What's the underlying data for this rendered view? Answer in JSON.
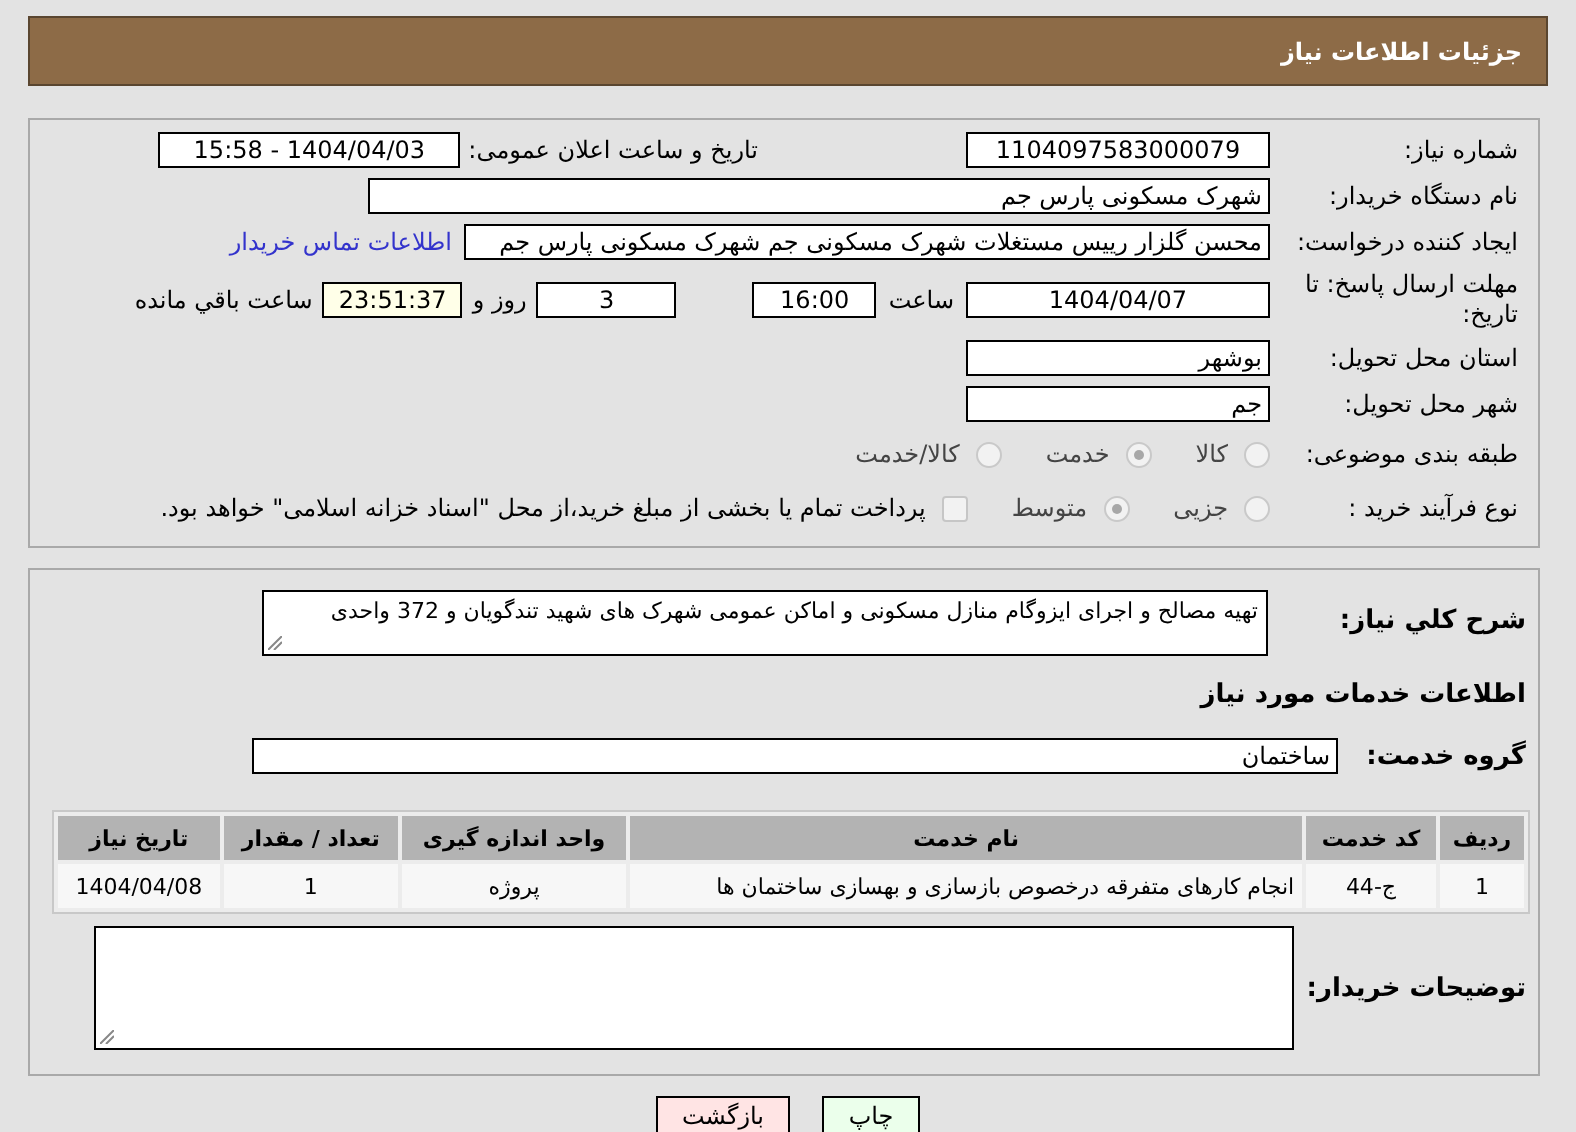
{
  "header": {
    "title": "جزئیات اطلاعات نیاز"
  },
  "details": {
    "need_number": {
      "label": "شماره نیاز:",
      "value": "1104097583000079"
    },
    "announce": {
      "label": "تاریخ و ساعت اعلان عمومی:",
      "value": "1404/04/03 - 15:58"
    },
    "buyer": {
      "label": "نام دستگاه خریدار:",
      "value": "شهرک مسکونی پارس جم"
    },
    "creator": {
      "label": "ایجاد کننده درخواست:",
      "value": "محسن گلزار رییس مستغلات شهرک مسکونی جم شهرک مسکونی پارس جم",
      "link": "اطلاعات تماس خریدار"
    },
    "deadline": {
      "label": "مهلت ارسال پاسخ: تا تاریخ:",
      "date": "1404/04/07",
      "time_label": "ساعت",
      "time": "16:00",
      "days": "3",
      "days_label": "روز و",
      "remaining": "23:51:37",
      "remaining_label": "ساعت باقي مانده"
    },
    "province": {
      "label": "استان محل تحویل:",
      "value": "بوشهر"
    },
    "city": {
      "label": "شهر محل تحویل:",
      "value": "جم"
    },
    "category": {
      "label": "طبقه بندی موضوعی:",
      "options": [
        {
          "label": "کالا",
          "selected": false
        },
        {
          "label": "خدمت",
          "selected": true
        },
        {
          "label": "کالا/خدمت",
          "selected": false
        }
      ]
    },
    "process": {
      "label": "نوع فرآیند خرید :",
      "options": [
        {
          "label": "جزیی",
          "selected": false
        },
        {
          "label": "متوسط",
          "selected": true
        }
      ],
      "payment": {
        "label": "پرداخت تمام یا بخشی از مبلغ خرید،از محل \"اسناد خزانه اسلامی\" خواهد بود.",
        "checked": false
      }
    }
  },
  "need": {
    "description": {
      "label": "شرح كلي نياز:",
      "value": "تهیه مصالح و اجرای ایزوگام منازل مسکونی و اماکن عمومی شهرک های شهید تندگویان و 372 واحدی"
    },
    "services_title": "اطلاعات خدمات مورد نیاز",
    "service_group": {
      "label": "گروه خدمت:",
      "value": "ساختمان"
    },
    "table": {
      "columns": [
        "ردیف",
        "کد خدمت",
        "نام خدمت",
        "واحد اندازه گیری",
        "تعداد / مقدار",
        "تاریخ نیاز"
      ],
      "rows": [
        [
          "1",
          "ج-44",
          "انجام کارهای متفرقه درخصوص بازسازی و بهسازی ساختمان ها",
          "پروژه",
          "1",
          "1404/04/08"
        ]
      ]
    },
    "buyer_notes": {
      "label": "توضیحات خریدار:"
    }
  },
  "buttons": [
    {
      "label": "چاپ",
      "kind": "print"
    },
    {
      "label": "بازگشت",
      "kind": "back"
    }
  ]
}
